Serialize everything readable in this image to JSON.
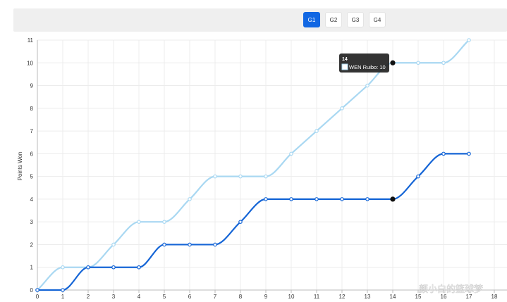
{
  "tabs": [
    {
      "label": "G1",
      "active": true
    },
    {
      "label": "G2",
      "active": false
    },
    {
      "label": "G3",
      "active": false
    },
    {
      "label": "G4",
      "active": false
    }
  ],
  "tooltip": {
    "title": "14",
    "text": "WEN Ruibo: 10"
  },
  "watermark": "颜小白的篮球梦",
  "chart_data": {
    "type": "line",
    "title": "",
    "xlabel": "",
    "ylabel": "Points Won",
    "xlim": [
      0,
      18
    ],
    "ylim": [
      0,
      11
    ],
    "x_ticks": [
      0,
      1,
      2,
      3,
      4,
      5,
      6,
      7,
      8,
      9,
      10,
      11,
      12,
      13,
      14,
      15,
      16,
      17,
      18
    ],
    "y_ticks": [
      0,
      1,
      2,
      3,
      4,
      5,
      6,
      7,
      8,
      9,
      10,
      11
    ],
    "grid": true,
    "x": [
      0,
      1,
      2,
      3,
      4,
      5,
      6,
      7,
      8,
      9,
      10,
      11,
      12,
      13,
      14,
      15,
      16,
      17
    ],
    "series": [
      {
        "name": "WEN Ruibo",
        "color": "#a9d8f2",
        "values": [
          0,
          1,
          1,
          2,
          3,
          3,
          4,
          5,
          5,
          5,
          6,
          7,
          8,
          9,
          10,
          10,
          10,
          11
        ]
      },
      {
        "color": "#1565d6",
        "values": [
          0,
          0,
          1,
          1,
          1,
          2,
          2,
          2,
          3,
          4,
          4,
          4,
          4,
          4,
          4,
          5,
          6,
          6
        ]
      }
    ],
    "highlight_x": 14
  }
}
